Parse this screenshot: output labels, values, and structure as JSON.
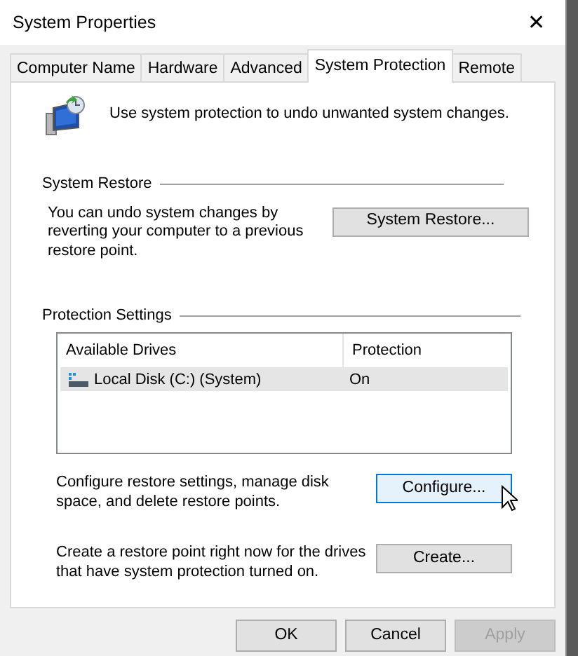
{
  "window": {
    "title": "System Properties",
    "close": "✕"
  },
  "tabs": [
    {
      "label": "Computer Name",
      "selected": false
    },
    {
      "label": "Hardware",
      "selected": false
    },
    {
      "label": "Advanced",
      "selected": false
    },
    {
      "label": "System Protection",
      "selected": true
    },
    {
      "label": "Remote",
      "selected": false
    }
  ],
  "intro": "Use system protection to undo unwanted system changes.",
  "system_restore": {
    "heading": "System Restore",
    "description": "You can undo system changes by reverting your computer to a previous restore point.",
    "button": {
      "label": "System Restore...",
      "focused": false
    }
  },
  "protection_settings": {
    "heading": "Protection Settings",
    "columns": [
      "Available Drives",
      "Protection"
    ],
    "rows": [
      {
        "drive": "Local Disk (C:) (System)",
        "protection": "On",
        "selected": true
      }
    ]
  },
  "actions": [
    {
      "description": "Configure restore settings, manage disk space, and delete restore points.",
      "button": {
        "label": "Configure...",
        "focused": true
      }
    },
    {
      "description": "Create a restore point right now for the drives that have system protection turned on.",
      "button": {
        "label": "Create...",
        "focused": false
      }
    }
  ],
  "buttons": [
    {
      "label": "OK",
      "disabled": false
    },
    {
      "label": "Cancel",
      "disabled": false
    },
    {
      "label": "Apply",
      "disabled": true
    }
  ]
}
